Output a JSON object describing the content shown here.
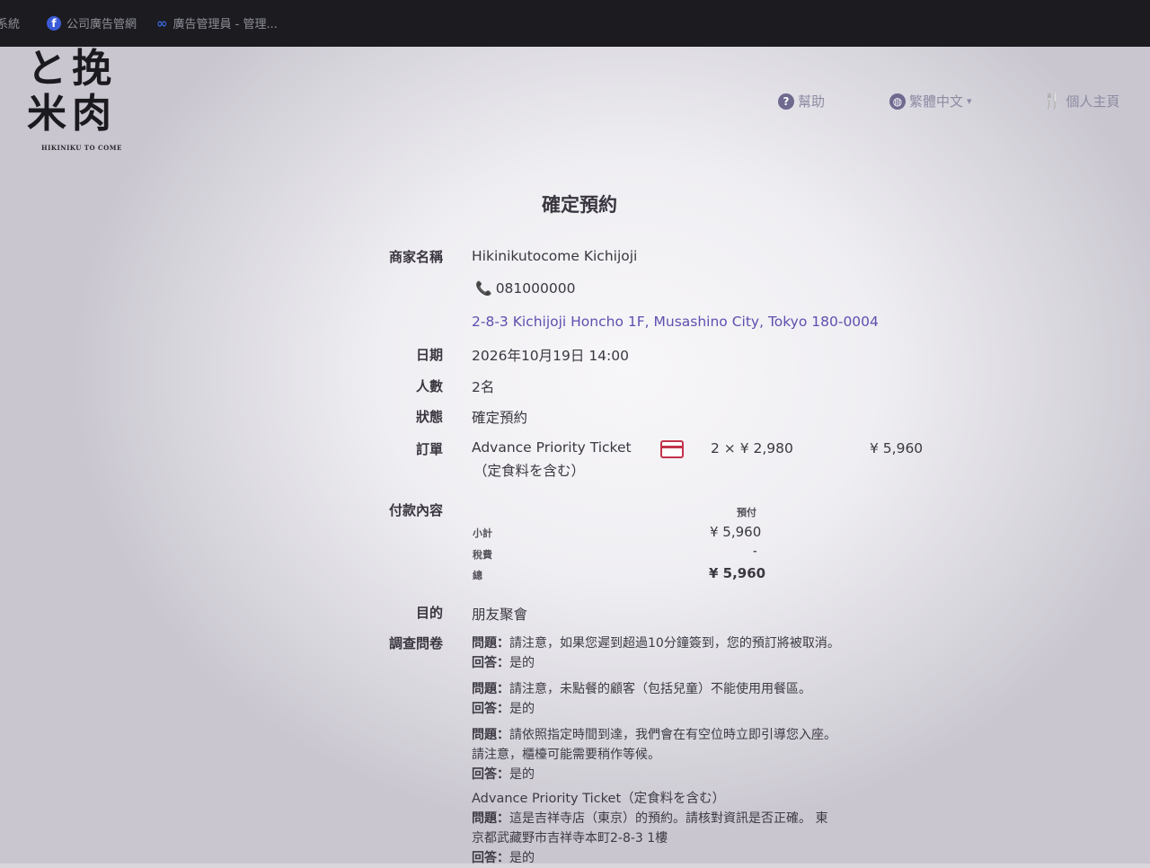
{
  "bookmarks": [
    {
      "label": "系統",
      "icon": "none"
    },
    {
      "label": "公司廣告管網",
      "icon": "facebook-icon"
    },
    {
      "label": "廣告管理員 - 管理...",
      "icon": "meta-icon"
    }
  ],
  "logo": {
    "line1": "と挽",
    "line2": "米肉",
    "sub": "HIKINIKU TO COME"
  },
  "nav": {
    "help": "幫助",
    "language": "繁體中文",
    "language_arrow": "▾",
    "account": "個人主頁"
  },
  "title": "確定預約",
  "labels": {
    "merchant": "商家名稱",
    "date": "日期",
    "people": "人數",
    "status": "狀態",
    "order": "訂單",
    "payment": "付款內容",
    "purpose": "目的",
    "survey": "調查問卷"
  },
  "merchant": {
    "name": "Hikinikutocome Kichijoji",
    "phone": "081000000",
    "address": "2-8-3 Kichijoji Honcho 1F, Musashino City, Tokyo 180-0004"
  },
  "date": "2026年10月19日 14:00",
  "people": "2名",
  "status": "確定預約",
  "order": {
    "item": "Advance Priority Ticket",
    "item_note": "（定食料を含む）",
    "qty_price": "2 × ¥ 2,980",
    "total": "¥ 5,960"
  },
  "payment": {
    "column": "預付",
    "subtotal_label": "小計",
    "subtotal": "¥ 5,960",
    "tax_label": "稅費",
    "tax": "-",
    "total_label": "總",
    "total": "¥ 5,960"
  },
  "purpose": "朋友聚會",
  "survey": {
    "q_label": "問題：",
    "a_label": "回答：",
    "items": [
      {
        "q": "請注意，如果您遲到超過10分鐘簽到，您的預訂將被取消。",
        "q2": "",
        "a": "是的"
      },
      {
        "q": "請注意，未點餐的顧客（包括兒童）不能使用用餐區。",
        "q2": "",
        "a": "是的"
      },
      {
        "q": "請依照指定時間到達，我們會在有空位時立即引導您入座。",
        "q2": "請注意，櫃檯可能需要稍作等候。",
        "a": "是的"
      }
    ],
    "ticket_header": "Advance Priority Ticket（定食料を含む）",
    "ticket_q": "這是吉祥寺店（東京）的預約。請核對資訊是否正確。 東",
    "ticket_q2": "京都武藏野市吉祥寺本町2-8-3 1樓",
    "ticket_a": "是的"
  }
}
